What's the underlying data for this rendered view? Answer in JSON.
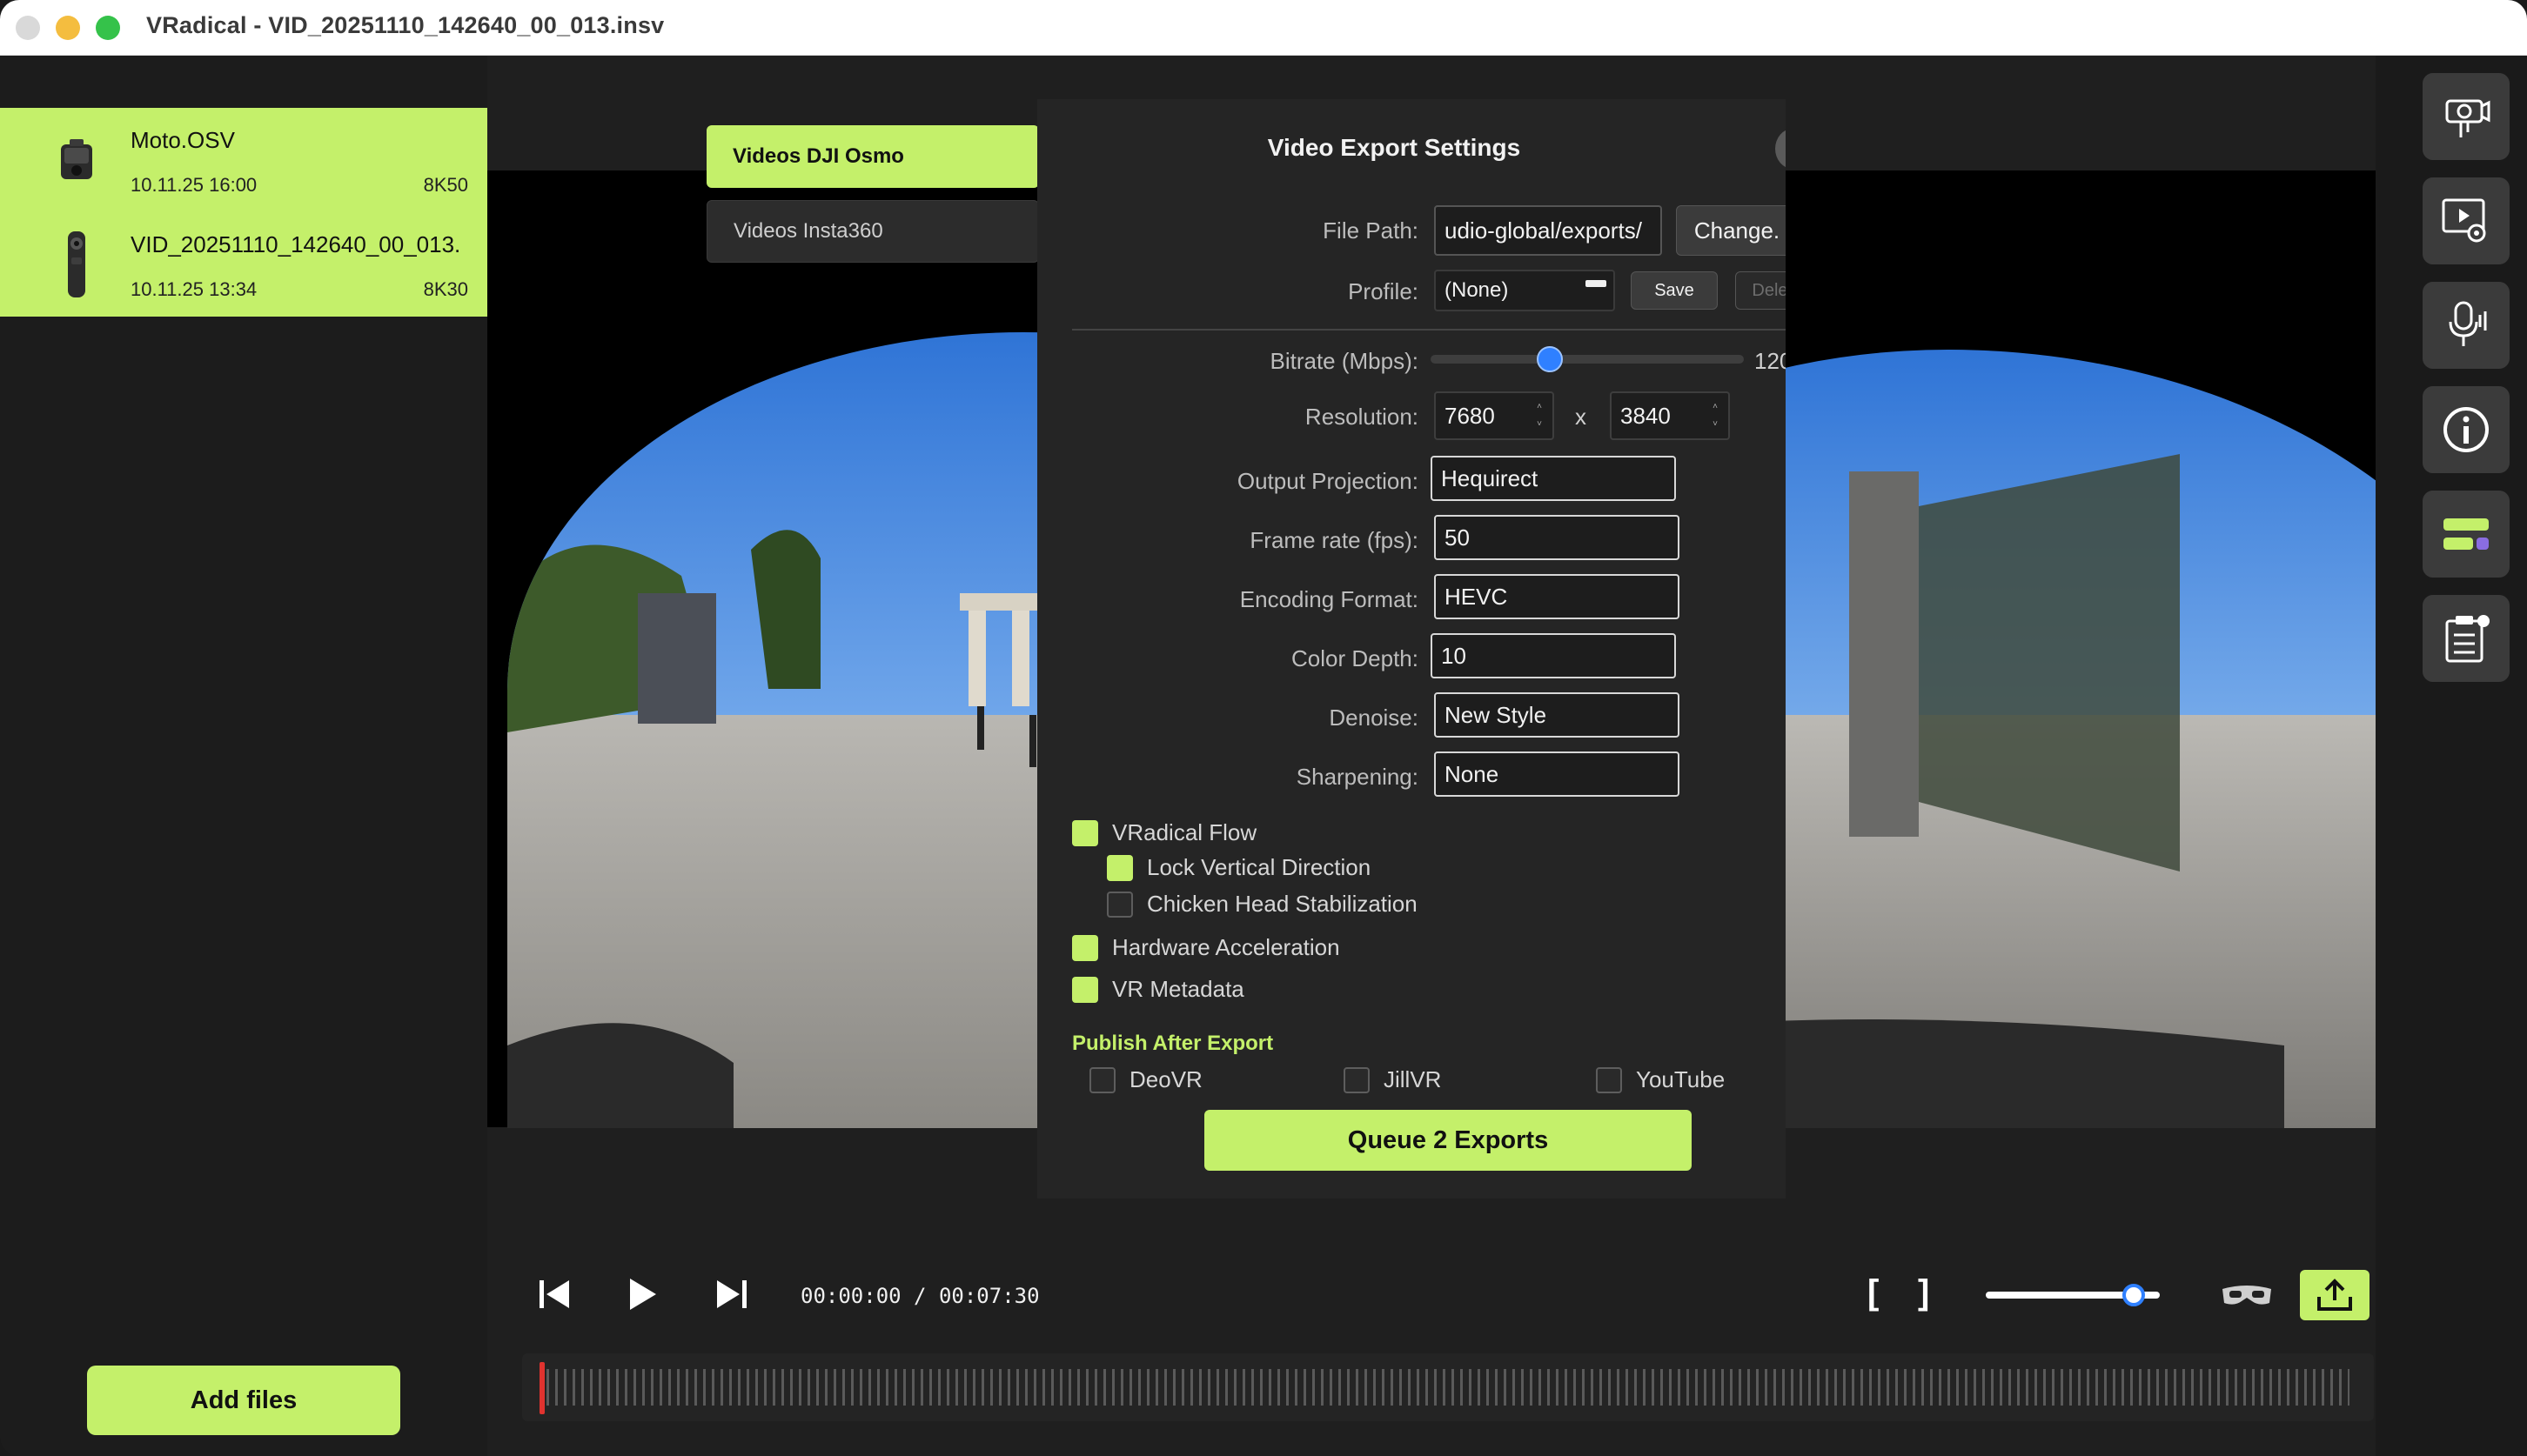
{
  "window": {
    "title": "VRadical - VID_20251110_142640_00_013.insv"
  },
  "sidebar": {
    "files": [
      {
        "name": "Moto.OSV",
        "date": "10.11.25 16:00",
        "resolution": "8K50",
        "icon": "action-camera-icon"
      },
      {
        "name": "VID_20251110_142640_00_013.",
        "date": "10.11.25 13:34",
        "resolution": "8K30",
        "icon": "360-camera-icon"
      }
    ],
    "add_files_label": "Add files"
  },
  "tabs": [
    {
      "label": "Videos DJI Osmo",
      "selected": true
    },
    {
      "label": "Videos Insta360",
      "selected": false
    }
  ],
  "export": {
    "title": "Video Export Settings",
    "file_path": {
      "label": "File Path:",
      "value": "udio-global/exports/",
      "button": "Change."
    },
    "profile": {
      "label": "Profile:",
      "value": "(None)",
      "save": "Save",
      "delete": "Dele"
    },
    "bitrate": {
      "label": "Bitrate (Mbps):",
      "value_text": "120",
      "fraction": 0.38
    },
    "resolution": {
      "label": "Resolution:",
      "width": "7680",
      "sep": "x",
      "height": "3840"
    },
    "projection": {
      "label": "Output Projection:",
      "value": "Hequirect"
    },
    "frame_rate": {
      "label": "Frame rate (fps):",
      "value": "50"
    },
    "encoding": {
      "label": "Encoding Format:",
      "value": "HEVC"
    },
    "color_depth": {
      "label": "Color Depth:",
      "value": "10"
    },
    "denoise": {
      "label": "Denoise:",
      "value": "New Style"
    },
    "sharpening": {
      "label": "Sharpening:",
      "value": "None"
    },
    "options": {
      "vradical_flow": {
        "label": "VRadical Flow",
        "checked": true
      },
      "lock_vertical": {
        "label": "Lock Vertical Direction",
        "checked": true
      },
      "chicken_head": {
        "label": "Chicken Head Stabilization",
        "checked": false
      },
      "hw_accel": {
        "label": "Hardware Acceleration",
        "checked": true
      },
      "vr_metadata": {
        "label": "VR Metadata",
        "checked": true
      }
    },
    "publish": {
      "title": "Publish After Export",
      "deovr": "DeoVR",
      "jillvr": "JillVR",
      "youtube": "YouTube"
    },
    "queue_label": "Queue 2 Exports"
  },
  "player": {
    "timecode": "00:00:00 / 00:07:30",
    "in_point": "[",
    "out_point": "]",
    "zoom_fraction": 0.85,
    "playhead_fraction": 0.0
  },
  "rail": {
    "icons": [
      "camera-settings-icon",
      "video-gear-icon",
      "audio-icon",
      "info-icon",
      "toggles-icon",
      "clipboard-list-icon"
    ]
  },
  "colors": {
    "accent": "#c4f06a",
    "panel": "#252525",
    "background": "#1f1f1f",
    "slider": "#2f80ff",
    "playhead": "#e0332f"
  }
}
